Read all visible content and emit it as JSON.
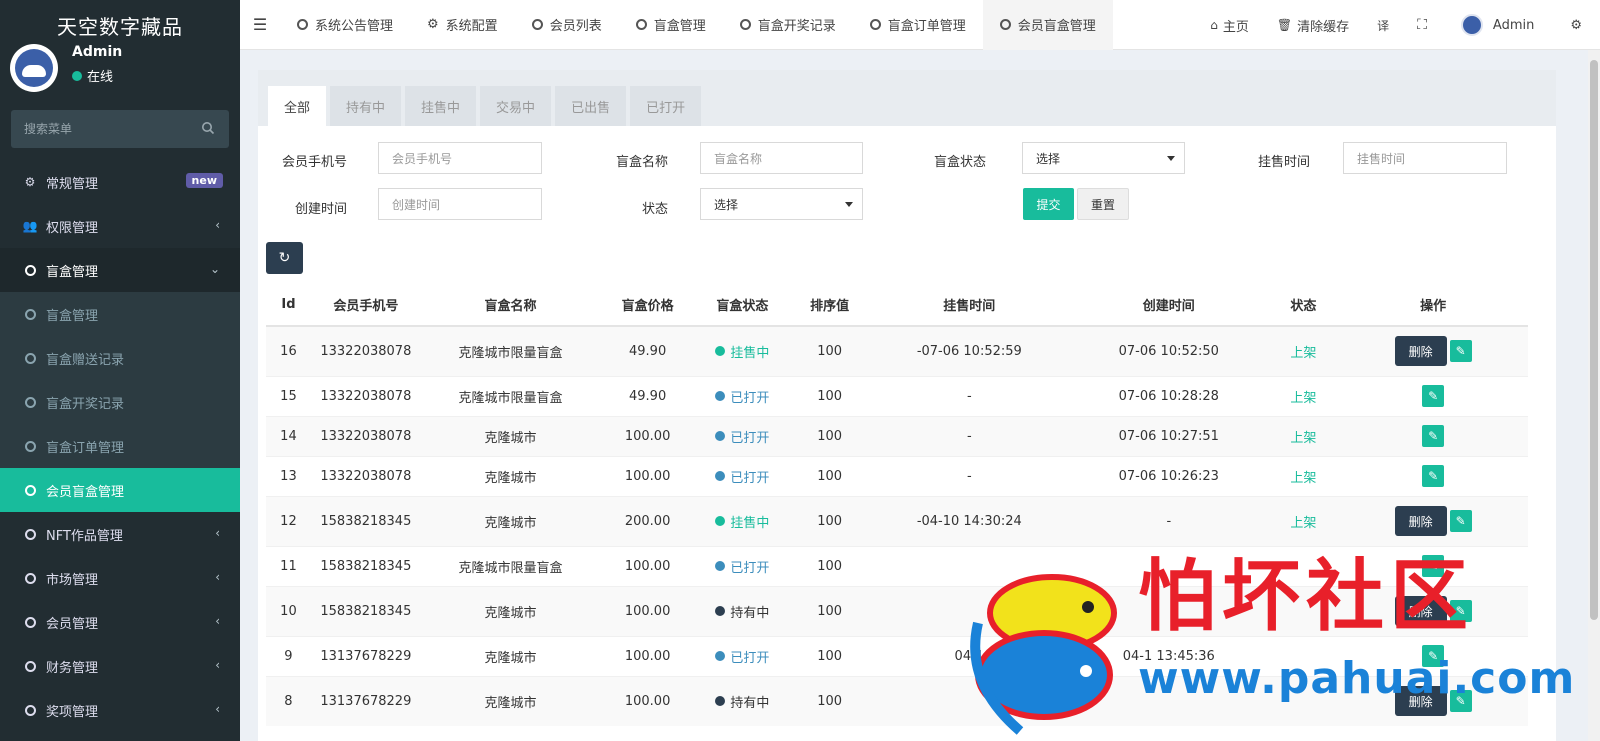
{
  "brand": "天空数字藏品",
  "user": {
    "name": "Admin",
    "status": "在线"
  },
  "sidebar_search_placeholder": "搜索菜单",
  "menu": [
    {
      "label": "常规管理",
      "icon": "cogs-icon",
      "badge": "new"
    },
    {
      "label": "权限管理",
      "icon": "users-icon"
    },
    {
      "label": "盲盒管理",
      "icon": "circle-icon",
      "open": true
    },
    {
      "label": "盲盒管理",
      "sub": true
    },
    {
      "label": "盲盒赠送记录",
      "sub": true
    },
    {
      "label": "盲盒开奖记录",
      "sub": true
    },
    {
      "label": "盲盒订单管理",
      "sub": true
    },
    {
      "label": "会员盲盒管理",
      "sub": true,
      "active": true
    },
    {
      "label": "NFT作品管理",
      "icon": "circle-icon"
    },
    {
      "label": "市场管理",
      "icon": "circle-icon"
    },
    {
      "label": "会员管理",
      "icon": "circle-icon"
    },
    {
      "label": "财务管理",
      "icon": "circle-icon"
    },
    {
      "label": "奖项管理",
      "icon": "circle-icon"
    }
  ],
  "top_tabs": [
    "系统公告管理",
    "系统配置",
    "会员列表",
    "盲盒管理",
    "盲盒开奖记录",
    "盲盒订单管理",
    "会员盲盒管理"
  ],
  "top_right": {
    "home": "主页",
    "clear_cache": "清除缓存",
    "admin": "Admin"
  },
  "filter_tabs": [
    "全部",
    "持有中",
    "挂售中",
    "交易中",
    "已出售",
    "已打开"
  ],
  "form": {
    "phone_label": "会员手机号",
    "phone_placeholder": "会员手机号",
    "name_label": "盲盒名称",
    "name_placeholder": "盲盒名称",
    "box_status_label": "盲盒状态",
    "box_status_value": "选择",
    "sale_time_label": "挂售时间",
    "sale_time_placeholder": "挂售时间",
    "create_time_label": "创建时间",
    "create_time_placeholder": "创建时间",
    "status_label": "状态",
    "status_value": "选择",
    "submit": "提交",
    "reset": "重置"
  },
  "table": {
    "headers": [
      "Id",
      "会员手机号",
      "盲盒名称",
      "盲盒价格",
      "盲盒状态",
      "排序值",
      "挂售时间",
      "创建时间",
      "状态",
      "操作"
    ],
    "rows": [
      {
        "id": "16",
        "phone": "13322038078",
        "name": "克隆城市限量盲盒",
        "price": "49.90",
        "status": "挂售中",
        "stype": "sale",
        "sort": "100",
        "sale_time": "-07-06 10:52:59",
        "create_time": "07-06 10:52:50",
        "state": "上架",
        "del": true
      },
      {
        "id": "15",
        "phone": "13322038078",
        "name": "克隆城市限量盲盒",
        "price": "49.90",
        "status": "已打开",
        "stype": "open",
        "sort": "100",
        "sale_time": "-",
        "create_time": "07-06 10:28:28",
        "state": "上架",
        "del": false
      },
      {
        "id": "14",
        "phone": "13322038078",
        "name": "克隆城市",
        "price": "100.00",
        "status": "已打开",
        "stype": "open",
        "sort": "100",
        "sale_time": "-",
        "create_time": "07-06 10:27:51",
        "state": "上架",
        "del": false
      },
      {
        "id": "13",
        "phone": "13322038078",
        "name": "克隆城市",
        "price": "100.00",
        "status": "已打开",
        "stype": "open",
        "sort": "100",
        "sale_time": "-",
        "create_time": "07-06 10:26:23",
        "state": "上架",
        "del": false
      },
      {
        "id": "12",
        "phone": "15838218345",
        "name": "克隆城市",
        "price": "200.00",
        "status": "挂售中",
        "stype": "sale",
        "sort": "100",
        "sale_time": "-04-10 14:30:24",
        "create_time": "-",
        "state": "上架",
        "del": true
      },
      {
        "id": "11",
        "phone": "15838218345",
        "name": "克隆城市限量盲盒",
        "price": "100.00",
        "status": "已打开",
        "stype": "open",
        "sort": "100",
        "sale_time": "",
        "create_time": "",
        "state": "",
        "del": false
      },
      {
        "id": "10",
        "phone": "15838218345",
        "name": "克隆城市",
        "price": "100.00",
        "status": "持有中",
        "stype": "hold",
        "sort": "100",
        "sale_time": "",
        "create_time": "",
        "state": "",
        "del": true
      },
      {
        "id": "9",
        "phone": "13137678229",
        "name": "克隆城市",
        "price": "100.00",
        "status": "已打开",
        "stype": "open",
        "sort": "100",
        "sale_time": "04-1",
        "create_time": "04-1 13:45:36",
        "state": "",
        "del": false
      },
      {
        "id": "8",
        "phone": "13137678229",
        "name": "克隆城市",
        "price": "100.00",
        "status": "持有中",
        "stype": "hold",
        "sort": "100",
        "sale_time": "",
        "create_time": "",
        "state": "",
        "del": true
      }
    ],
    "delete_label": "删除"
  },
  "watermark": {
    "text": "怕坏社区",
    "url": "www.pahuai.com"
  },
  "colors": {
    "accent": "#18bc9c",
    "sidebar": "#222d32",
    "dark_button": "#2c3e50",
    "open_status": "#3c8dbc",
    "badge": "#605ca8"
  }
}
